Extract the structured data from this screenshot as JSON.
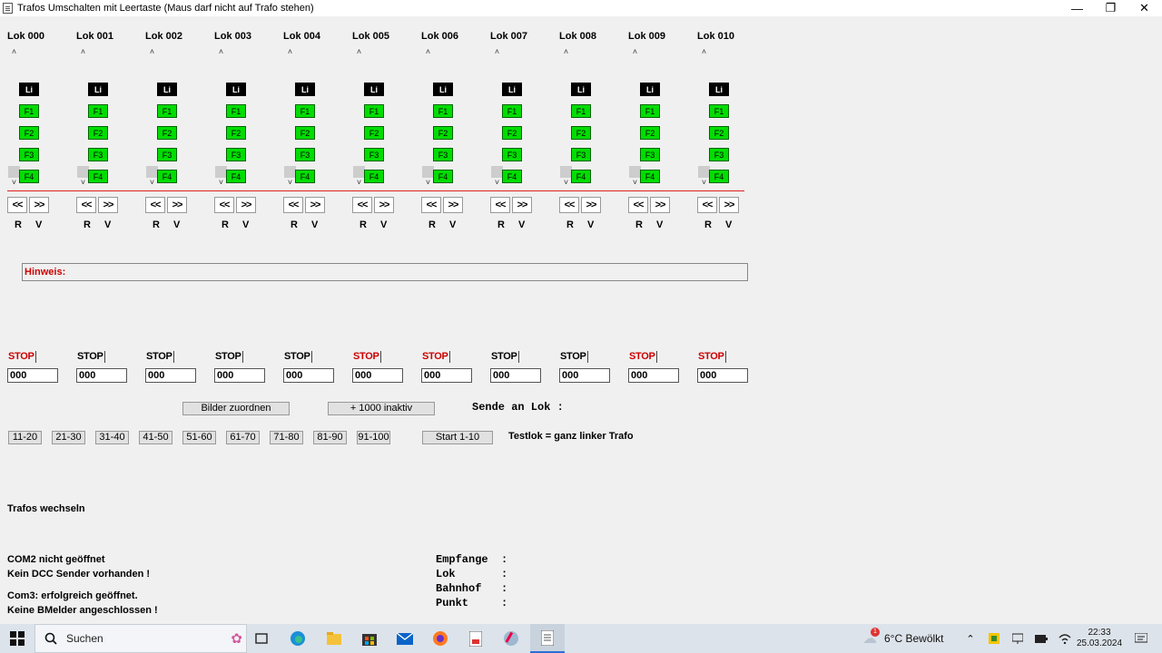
{
  "window": {
    "title": "Trafos  Umschalten mit Leertaste (Maus darf nicht auf Trafo stehen)"
  },
  "loks": [
    {
      "title": "Lok 000",
      "stop": "STOP",
      "stop_color": "#cc0000",
      "value": "000"
    },
    {
      "title": "Lok 001",
      "stop": "STOP",
      "stop_color": "#000000",
      "value": "000"
    },
    {
      "title": "Lok 002",
      "stop": "STOP",
      "stop_color": "#000000",
      "value": "000"
    },
    {
      "title": "Lok 003",
      "stop": "STOP",
      "stop_color": "#000000",
      "value": "000"
    },
    {
      "title": "Lok 004",
      "stop": "STOP",
      "stop_color": "#000000",
      "value": "000"
    },
    {
      "title": "Lok 005",
      "stop": "STOP",
      "stop_color": "#cc0000",
      "value": "000"
    },
    {
      "title": "Lok 006",
      "stop": "STOP",
      "stop_color": "#cc0000",
      "value": "000"
    },
    {
      "title": "Lok 007",
      "stop": "STOP",
      "stop_color": "#000000",
      "value": "000"
    },
    {
      "title": "Lok 008",
      "stop": "STOP",
      "stop_color": "#000000",
      "value": "000"
    },
    {
      "title": "Lok 009",
      "stop": "STOP",
      "stop_color": "#cc0000",
      "value": "000"
    },
    {
      "title": "Lok 010",
      "stop": "STOP",
      "stop_color": "#cc0000",
      "value": "000"
    }
  ],
  "functions": [
    "Li",
    "F1",
    "F2",
    "F3",
    "F4"
  ],
  "nav": {
    "back": "<<",
    "forward": ">>",
    "r": "R",
    "v": "V"
  },
  "hinweis": {
    "label": "Hinweis:"
  },
  "buttons": {
    "bilder": "Bilder zuordnen",
    "inaktiv": "+ 1000 inaktiv",
    "start": "Start 1-10"
  },
  "sende": "Sende an Lok :",
  "ranges": [
    "11-20",
    "21-30",
    "31-40",
    "41-50",
    "51-60",
    "61-70",
    "71-80",
    "81-90",
    "91-100"
  ],
  "testlok": "Testlok = ganz linker Trafo",
  "trafos": "Trafos wechseln",
  "status": [
    "COM2 nicht geöffnet",
    "Kein DCC Sender vorhanden !",
    "Com3: erfolgreich geöffnet.",
    "Keine BMelder angeschlossen !"
  ],
  "info": {
    "empfange": "Empfange  :",
    "lok": "Lok       :",
    "bahnhof": "Bahnhof   :",
    "punkt": "Punkt     :"
  },
  "taskbar": {
    "search": "Suchen",
    "weather": "6°C  Bewölkt",
    "time": "22:33",
    "date": "25.03.2024",
    "weather_badge": "1"
  }
}
